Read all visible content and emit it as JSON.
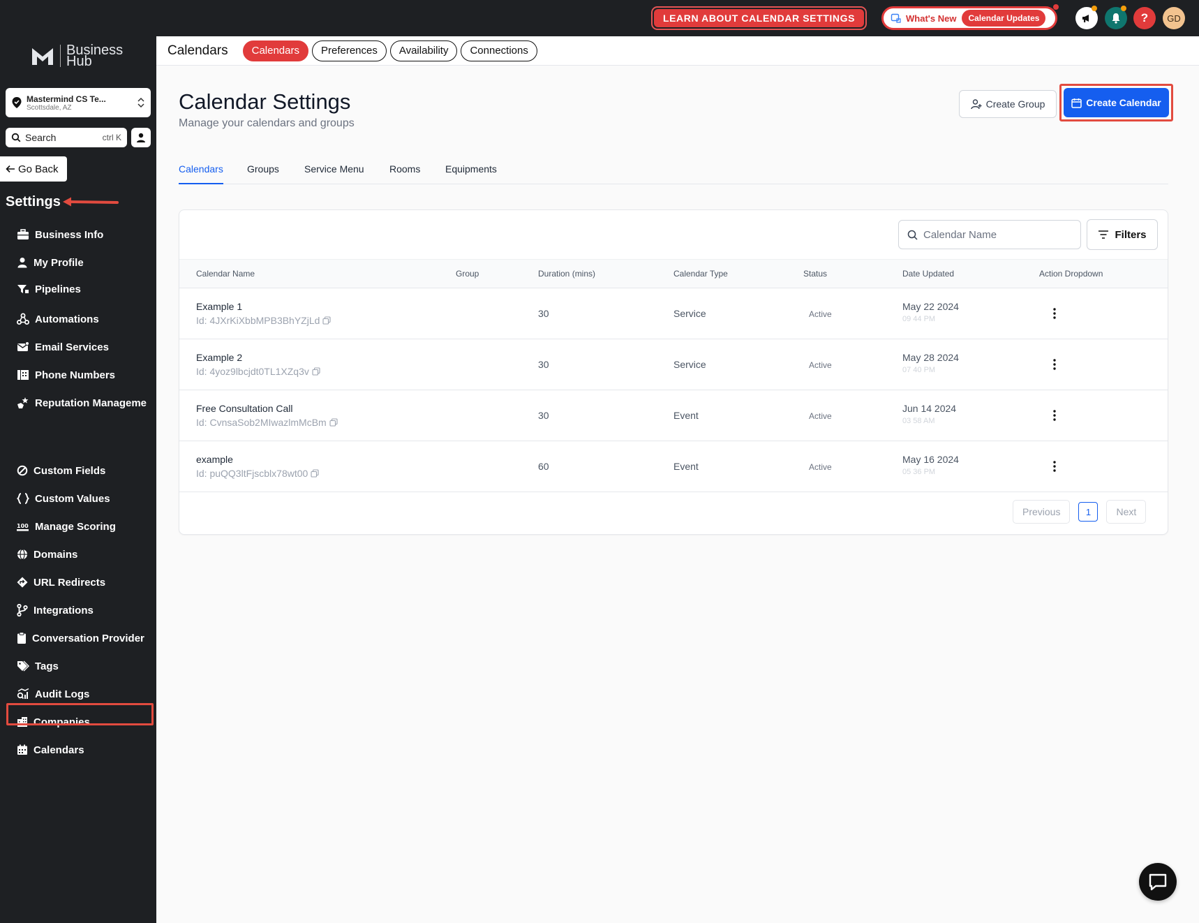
{
  "topbar": {
    "learn_label": "LEARN ABOUT CALENDAR SETTINGS",
    "whats_new_label": "What's New",
    "calendar_updates_label": "Calendar Updates",
    "avatar_initials": "GD",
    "help_label": "?",
    "accent_red": "#e13b3b"
  },
  "sidebar": {
    "logo_line1": "Business",
    "logo_line2": "Hub",
    "account_name": "Mastermind CS Te...",
    "account_location": "Scottsdale, AZ",
    "search_label": "Search",
    "search_shortcut": "ctrl K",
    "go_back_label": "Go Back",
    "settings_title": "Settings",
    "items": [
      {
        "label": "Business Info",
        "icon": "briefcase-icon"
      },
      {
        "label": "My Profile",
        "icon": "user-icon"
      },
      {
        "label": "Pipelines",
        "icon": "funnel-icon"
      },
      {
        "label": "Automations",
        "icon": "automation-icon"
      },
      {
        "label": "Email Services",
        "icon": "mail-icon"
      },
      {
        "label": "Phone Numbers",
        "icon": "phone-book-icon"
      },
      {
        "label": "Reputation Manageme",
        "icon": "star-hand-icon"
      },
      {
        "label": "Custom Fields",
        "icon": "custom-field-icon"
      },
      {
        "label": "Custom Values",
        "icon": "braces-icon"
      },
      {
        "label": "Manage Scoring",
        "icon": "scoring-icon"
      },
      {
        "label": "Domains",
        "icon": "globe-icon"
      },
      {
        "label": "URL Redirects",
        "icon": "redirect-icon"
      },
      {
        "label": "Integrations",
        "icon": "branch-icon"
      },
      {
        "label": "Conversation Provider",
        "icon": "clipboard-icon"
      },
      {
        "label": "Tags",
        "icon": "tags-icon"
      },
      {
        "label": "Audit Logs",
        "icon": "audit-icon"
      },
      {
        "label": "Companies",
        "icon": "building-icon"
      },
      {
        "label": "Calendars",
        "icon": "calendar-icon"
      }
    ]
  },
  "subheader": {
    "title": "Calendars",
    "pills": [
      "Calendars",
      "Preferences",
      "Availability",
      "Connections"
    ]
  },
  "main": {
    "title": "Calendar Settings",
    "subtitle": "Manage your calendars and groups",
    "create_group_label": "Create Group",
    "create_calendar_label": "Create Calendar",
    "tabs": [
      "Calendars",
      "Groups",
      "Service Menu",
      "Rooms",
      "Equipments"
    ],
    "search_placeholder": "Calendar Name",
    "filters_label": "Filters",
    "columns": [
      "Calendar Name",
      "Group",
      "Duration (mins)",
      "Calendar Type",
      "Status",
      "Date Updated",
      "Action Dropdown"
    ],
    "rows": [
      {
        "name": "Example 1",
        "id": "Id: 4JXrKiXbbMPB3BhYZjLd",
        "group": "",
        "duration": "30",
        "type": "Service",
        "status": "Active",
        "date": "May 22 2024",
        "time": "09 44 PM"
      },
      {
        "name": "Example 2",
        "id": "Id: 4yoz9lbcjdt0TL1XZq3v",
        "group": "",
        "duration": "30",
        "type": "Service",
        "status": "Active",
        "date": "May 28 2024",
        "time": "07 40 PM"
      },
      {
        "name": "Free Consultation Call",
        "id": "Id: CvnsaSob2MIwazlmMcBm",
        "group": "",
        "duration": "30",
        "type": "Event",
        "status": "Active",
        "date": "Jun 14 2024",
        "time": "03 58 AM"
      },
      {
        "name": "example",
        "id": "Id: puQQ3ltFjscblx78wt00",
        "group": "",
        "duration": "60",
        "type": "Event",
        "status": "Active",
        "date": "May 16 2024",
        "time": "05 36 PM"
      }
    ],
    "pagination": {
      "previous": "Previous",
      "page": "1",
      "next": "Next"
    }
  }
}
